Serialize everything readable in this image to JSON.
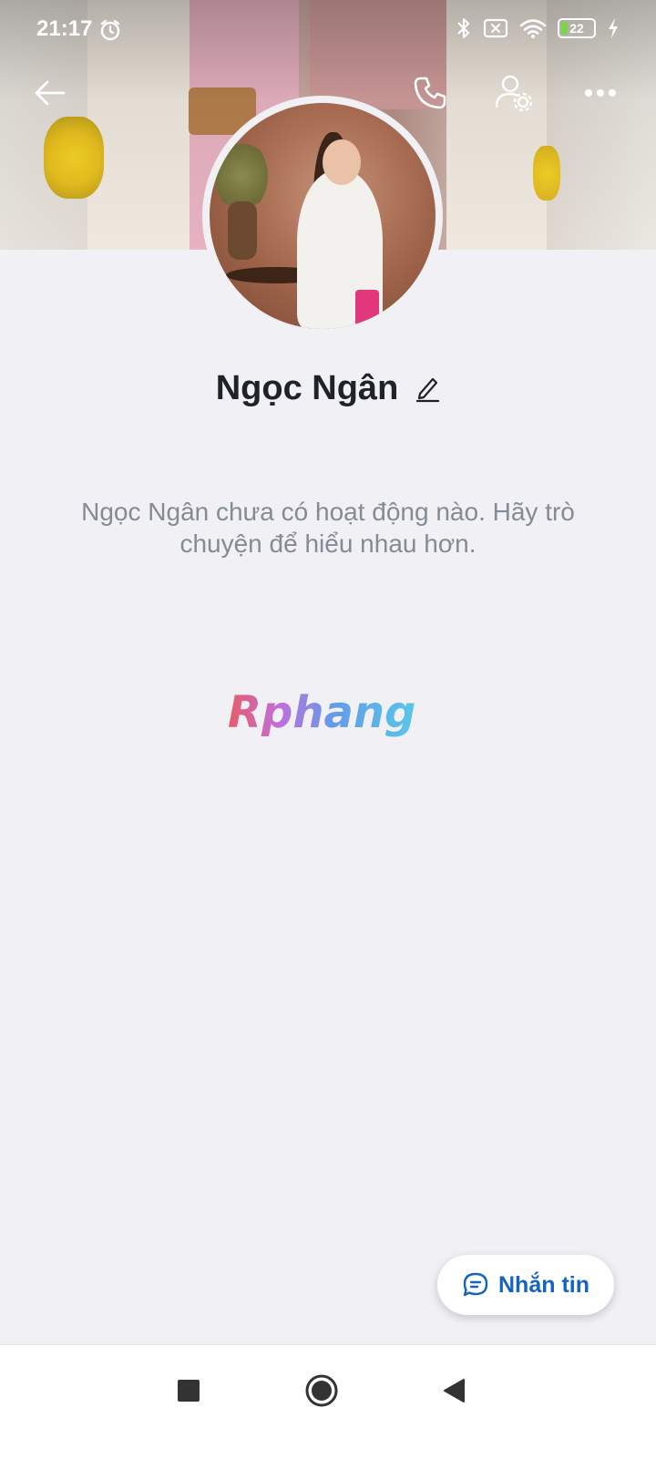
{
  "status_bar": {
    "time": "21:17",
    "battery_level": "22",
    "battery_fraction": 0.22,
    "icons": [
      "alarm-icon",
      "bluetooth-icon",
      "no-sim-icon",
      "wifi-icon",
      "battery-icon",
      "charging-icon"
    ]
  },
  "top_bar": {
    "icons": [
      "back-arrow-icon",
      "phone-call-icon",
      "user-settings-icon",
      "more-options-icon"
    ]
  },
  "profile": {
    "name": "Ngọc Ngân",
    "empty_message": "Ngọc Ngân chưa có hoạt động nào. Hãy trò chuyện để hiểu nhau hơn."
  },
  "watermark": {
    "text": "Rphang"
  },
  "message_button": {
    "label": "Nhắn tin",
    "icon": "chat-bubble-icon"
  },
  "nav_bar": {
    "icons": [
      "recents-square-icon",
      "home-circle-icon",
      "back-triangle-icon"
    ]
  },
  "colors": {
    "accent": "#1565c0",
    "background": "#f0f0f5",
    "text_primary": "#1f2329",
    "text_secondary": "#848b94"
  }
}
